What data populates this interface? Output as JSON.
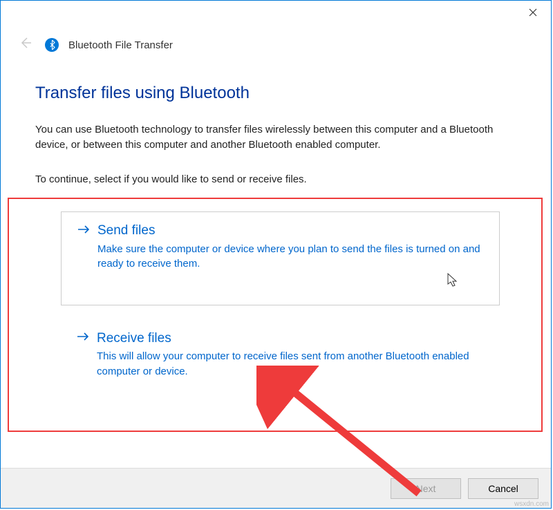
{
  "header": {
    "title": "Bluetooth File Transfer"
  },
  "page": {
    "heading": "Transfer files using Bluetooth",
    "intro": "You can use Bluetooth technology to transfer files wirelessly between this computer and a Bluetooth device, or between this computer and another Bluetooth enabled computer.",
    "instruction": "To continue, select if you would like to send or receive files."
  },
  "options": {
    "send": {
      "title": "Send files",
      "desc": "Make sure the computer or device where you plan to send the files is turned on and ready to receive them."
    },
    "receive": {
      "title": "Receive files",
      "desc": "This will allow your computer to receive files sent from another Bluetooth enabled computer or device."
    }
  },
  "footer": {
    "next": "Next",
    "cancel": "Cancel"
  },
  "watermark": "wsxdn.com"
}
